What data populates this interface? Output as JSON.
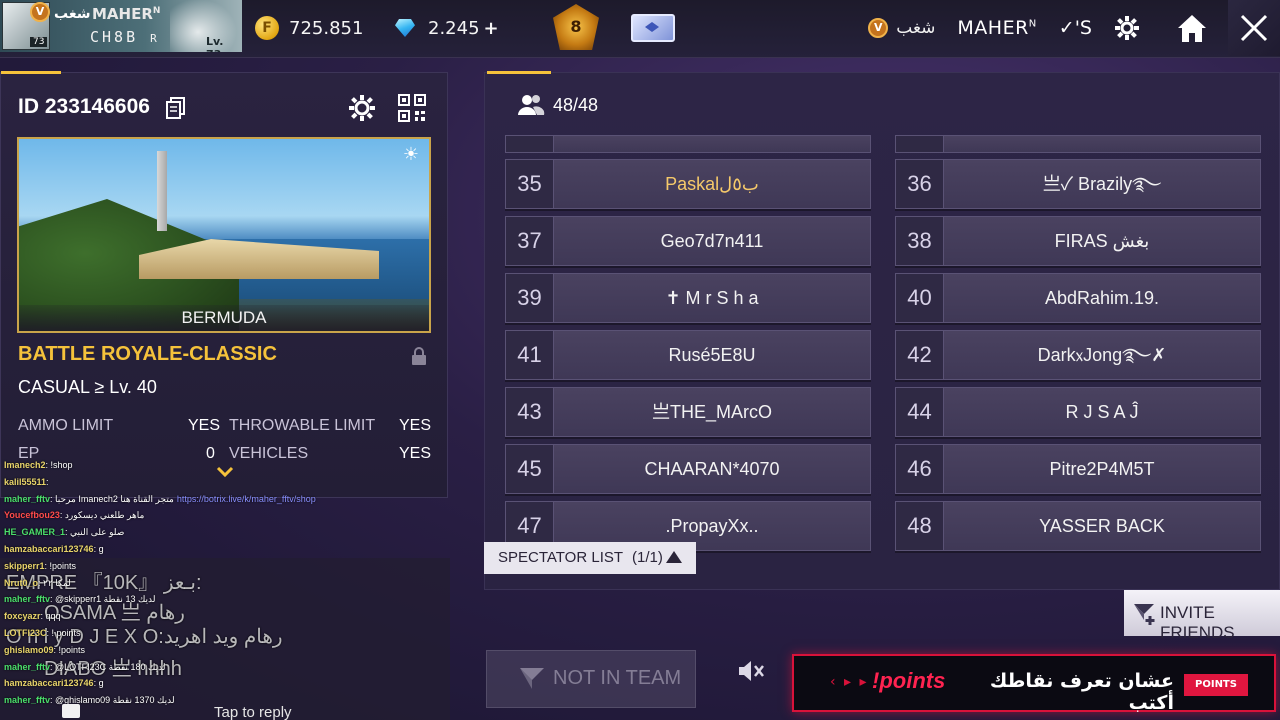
{
  "topbar": {
    "profile": {
      "vip_badge": "V",
      "clan_tag": "شغب",
      "name": "MAHER",
      "name_sup": "N",
      "tag": "CH8B",
      "tag_suffix": "R",
      "level_small": "73",
      "level": "Lv. 73"
    },
    "gold": "725.851",
    "diamonds": "2.245",
    "diamond_plus": "+",
    "rank_badge": "8",
    "right": {
      "vip_badge": "V",
      "clan_tag": "شغب",
      "name": "MAHER",
      "name_sup": "N",
      "signature": "✓'S"
    },
    "icons": {
      "gold": "gold-coin-icon",
      "diamond": "diamond-icon",
      "settings": "gear-icon",
      "home": "home-icon",
      "close": "close-icon"
    }
  },
  "room": {
    "id_label": "ID 233146606",
    "map_name": "BERMUDA",
    "mode": "BATTLE ROYALE-CLASSIC",
    "difficulty": "CASUAL ≥ Lv. 40",
    "rules": [
      {
        "label": "AMMO LIMIT",
        "value": "YES"
      },
      {
        "label": "THROWABLE LIMIT",
        "value": "YES"
      },
      {
        "label": "EP",
        "value": "0"
      },
      {
        "label": "VEHICLES",
        "value": "YES"
      }
    ]
  },
  "players": {
    "count": "48/48",
    "slots": [
      {
        "num": "35",
        "name": "Paskalب٥ل"
      },
      {
        "num": "36",
        "name": "亗✓ Brazily࿐"
      },
      {
        "num": "37",
        "name": "Geo7d7n411"
      },
      {
        "num": "38",
        "name": "FIRAS بغش"
      },
      {
        "num": "39",
        "name": "✝ M r S h a"
      },
      {
        "num": "40",
        "name": "AbdRahim.19."
      },
      {
        "num": "41",
        "name": "Rusé5E8U"
      },
      {
        "num": "42",
        "name": "Dark᥊Jong࿐✗"
      },
      {
        "num": "43",
        "name": "亗THE_MArcO"
      },
      {
        "num": "44",
        "name": "R J  S A Ĵ"
      },
      {
        "num": "45",
        "name": "CHAARAN*4070"
      },
      {
        "num": "46",
        "name": "Pitre2P4M5T"
      },
      {
        "num": "47",
        "name": ".PropayXx.."
      },
      {
        "num": "48",
        "name": "YASSER  BACK"
      }
    ]
  },
  "spectator": {
    "label": "SPECTATOR LIST",
    "count": "(1/1)"
  },
  "buttons": {
    "invite": "INVITE FRIENDS",
    "not_in_team": "NOT IN TEAM"
  },
  "banner": {
    "arrows": "‹ ▸ ▸",
    "brand": "!points",
    "text": "عشان تعرف نقاطك أكتب",
    "tag": "POINTS"
  },
  "chat": {
    "lines": [
      {
        "user": "Imanech2",
        "msg": ": !shop",
        "color": ""
      },
      {
        "user": "kalil55511",
        "msg": ": ",
        "color": ""
      },
      {
        "user": "maher_fftv",
        "msg": ": مرحبا Imanech2 متجر القناة هنا",
        "link": "https://botrix.live/k/maher_fftv/shop",
        "color": "green"
      },
      {
        "user": "Youcefbou23",
        "msg": ": ماهر طلعني ديسكورد",
        "color": "red"
      },
      {
        "user": "HE_GAMER_1",
        "msg": ": صلو على النبي",
        "color": "green"
      },
      {
        "user": "hamzabaccari123746",
        "msg": ": g",
        "color": ""
      },
      {
        "user": "skipperr1",
        "msg": ": !points",
        "color": ""
      },
      {
        "user": "Nrut0_o",
        "msg": ": لمكا ٢٢",
        "color": ""
      },
      {
        "user": "maher_fftv",
        "msg": ": @skipperr1 لديك 13 نقطة",
        "color": "green"
      },
      {
        "user": "foxcyazr",
        "msg": ": qqq",
        "color": ""
      },
      {
        "user": "LOTFI23C",
        "msg": ": ! points",
        "color": ""
      },
      {
        "user": "ghislamo09",
        "msg": ": !points",
        "color": ""
      },
      {
        "user": "maher_fftv",
        "msg": ": @LOTFI23C لديك 180 نقطة",
        "color": "green"
      },
      {
        "user": "hamzabaccari123746",
        "msg": ": g",
        "color": ""
      },
      {
        "user": "maher_fftv",
        "msg": ": @ghislamo09 لديك 1370 نقطة",
        "color": "green"
      }
    ],
    "tap_reply": "Tap to reply"
  }
}
